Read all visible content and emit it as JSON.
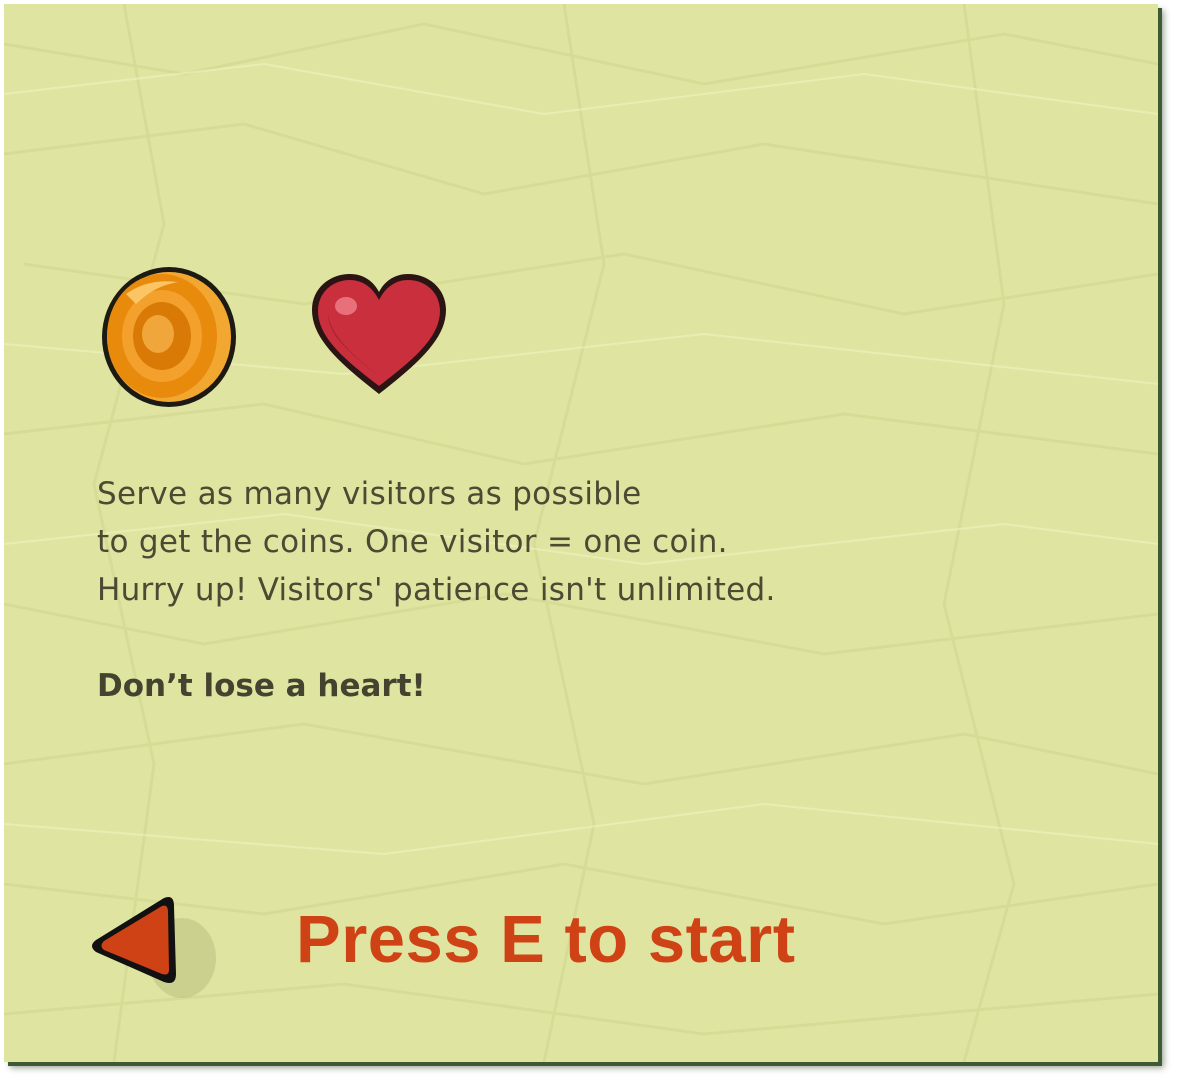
{
  "instructions": {
    "lines": [
      "Serve as many visitors as possible",
      "to get the coins. One visitor = one coin.",
      "Hurry up! Visitors' patience isn't unlimited."
    ],
    "warning": "Don’t lose a heart!"
  },
  "start": {
    "label": "Press E to start"
  },
  "icons": {
    "coin": "coin-icon",
    "heart": "heart-icon",
    "back": "back-arrow-icon"
  },
  "colors": {
    "paper": "#dfe5a1",
    "start_text": "#cf4215",
    "body_text": "#4b4a33",
    "coin": "#e88a0c",
    "heart": "#c92f3c",
    "arrow": "#cf4215"
  }
}
